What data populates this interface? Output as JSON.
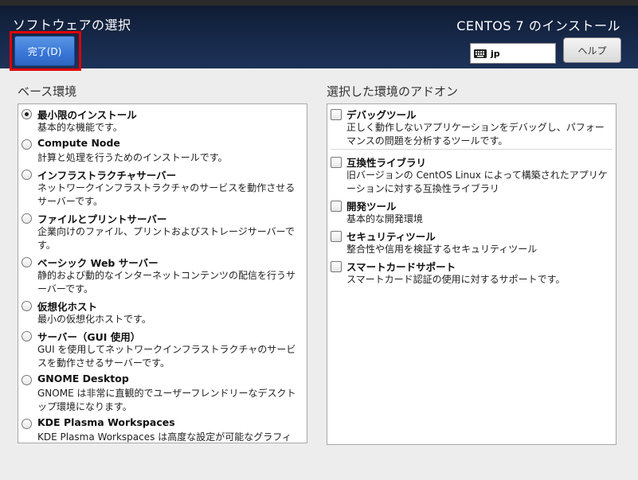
{
  "header": {
    "spoke_title": "ソフトウェアの選択",
    "done_button_label": "完了(D)",
    "product_title": "CENTOS 7 のインストール",
    "keyboard_layout": "jp",
    "help_button_label": "ヘルプ"
  },
  "base_environment": {
    "heading": "ベース環境",
    "selected_index": 0,
    "items": [
      {
        "name": "最小限のインストール",
        "description": "基本的な機能です。",
        "selected": true
      },
      {
        "name": "Compute Node",
        "description": "計算と処理を行うためのインストールです。",
        "selected": false
      },
      {
        "name": "インフラストラクチャサーバー",
        "description": "ネットワークインフラストラクチャのサービスを動作させるサーバーです。",
        "selected": false
      },
      {
        "name": "ファイルとプリントサーバー",
        "description": "企業向けのファイル、プリントおよびストレージサーバーです。",
        "selected": false
      },
      {
        "name": "ベーシック Web サーバー",
        "description": "静的および動的なインターネットコンテンツの配信を行うサーバーです。",
        "selected": false
      },
      {
        "name": "仮想化ホスト",
        "description": "最小の仮想化ホストです。",
        "selected": false
      },
      {
        "name": "サーバー（GUI 使用）",
        "description": "GUI を使用してネットワークインフラストラクチャのサービスを動作させるサーバーです。",
        "selected": false
      },
      {
        "name": "GNOME Desktop",
        "description": "GNOME は非常に直観的でユーザーフレンドリーなデスクトップ環境になります。",
        "selected": false
      },
      {
        "name": "KDE Plasma Workspaces",
        "description": "KDE Plasma Workspaces は高度な設定が可能なグラフィ",
        "selected": false
      }
    ]
  },
  "addons": {
    "heading": "選択した環境のアドオン",
    "items": [
      {
        "name": "デバッグツール",
        "description": "正しく動作しないアプリケーションをデバッグし、パフォーマンスの問題を分析するツールです。",
        "checked": false
      },
      {
        "name": "互換性ライブラリ",
        "description": "旧バージョンの CentOS Linux によって構築されたアプリケーションに対する互換性ライブラリ",
        "checked": false
      },
      {
        "name": "開発ツール",
        "description": "基本的な開発環境",
        "checked": false
      },
      {
        "name": "セキュリティツール",
        "description": "整合性や信用を検証するセキュリティツール",
        "checked": false
      },
      {
        "name": "スマートカードサポート",
        "description": "スマートカード認証の使用に対するサポートです。",
        "checked": false
      }
    ]
  },
  "colors": {
    "header_bg": "#17294a",
    "done_button": "#3875d7",
    "highlight_frame": "#e00000"
  },
  "icons": {
    "keyboard": "keyboard-icon"
  }
}
